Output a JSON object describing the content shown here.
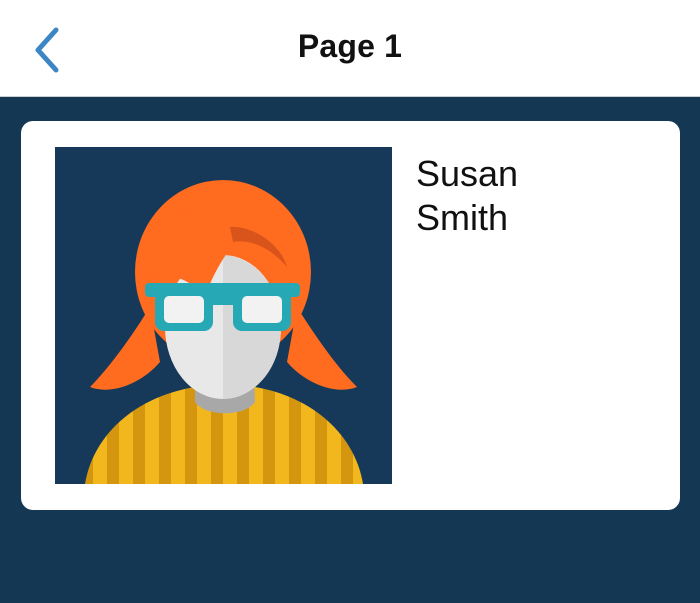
{
  "navbar": {
    "title": "Page 1",
    "back_icon": "chevron-left-icon",
    "accent_color": "#3d86c6"
  },
  "contact": {
    "first_name": "Susan",
    "last_name": "Smith",
    "avatar_icon": "female-avatar-with-glasses"
  },
  "colors": {
    "background": "#143753",
    "card": "#ffffff",
    "hair": "#ff6b1f",
    "glasses": "#27a9b5",
    "sweater": "#f3b71e"
  }
}
